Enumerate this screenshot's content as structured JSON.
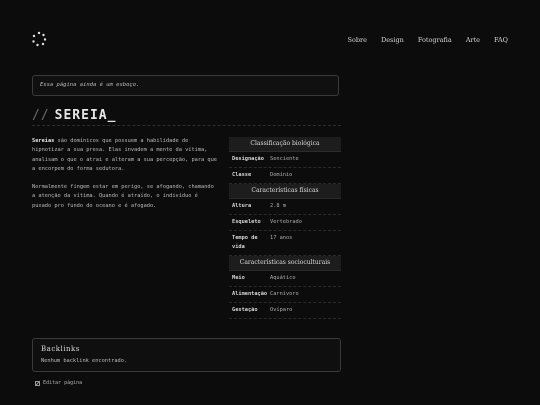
{
  "nav": {
    "items": [
      "Sobre",
      "Design",
      "Fotografia",
      "Arte",
      "FAQ"
    ]
  },
  "notice": "Essa página ainda é um esboço.",
  "page": {
    "title_prefix": "//",
    "title": "SEREIA",
    "cursor": "_"
  },
  "intro": {
    "p1_bold": "Sereias",
    "p1_rest": " são domínicos que possuem a habilidade de hipnotizar a sua presa. Elas invadem a mente da vítima, analisam o que o atrai e alteram a sua percepção, para que a encorpem do forma sedutora.",
    "p2": "Normalmente fingem estar em perigo, se afogando, chamando a atenção da vítima. Quando é atraído, o indivíduo é puxado pro fundo do oceano e é afogado."
  },
  "infobox": {
    "section1": "Classificação biológica",
    "designacao_key": "Designação",
    "designacao_val": "Senciente",
    "classe_key": "Classe",
    "classe_val": "Domínio",
    "section2": "Características físicas",
    "altura_key": "Altura",
    "altura_val": "2.8 m",
    "esqueleto_key": "Esqueleto",
    "esqueleto_val": "Vertebrado",
    "tempo_key": "Tempo de vida",
    "tempo_val": "17 anos",
    "section3": "Características socioculturais",
    "meio_key": "Meio",
    "meio_val": "Aquático",
    "alimentacao_key": "Alimentação",
    "alimentacao_val": "Carnívoro",
    "gestacao_key": "Gestação",
    "gestacao_val": "Ovíparo"
  },
  "backlinks": {
    "title": "Backlinks",
    "text": "Nenhum backlink encontrado."
  },
  "edit_label": "Editar página"
}
